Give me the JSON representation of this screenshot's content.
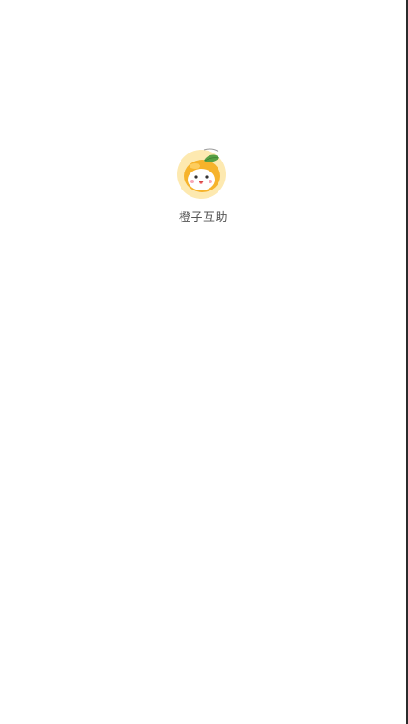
{
  "app": {
    "name": "橙子互助",
    "logo_icon": "orange-mascot-icon"
  },
  "colors": {
    "background": "#ffffff",
    "logo_ring": "#fde9b0",
    "orange_body": "#f6b32b",
    "leaf": "#58a145",
    "label_text": "#555555"
  }
}
